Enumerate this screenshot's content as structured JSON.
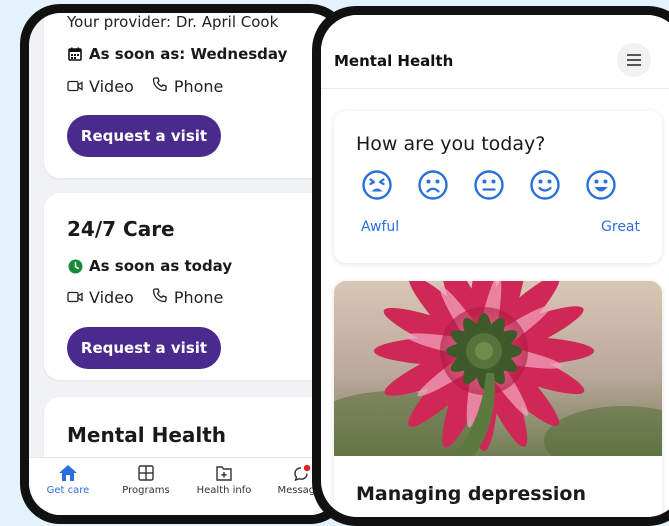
{
  "left": {
    "card1": {
      "provider": "Your provider: Dr. April Cook",
      "availability": "As soon as: Wednesday",
      "video_label": "Video",
      "phone_label": "Phone",
      "button": "Request a visit"
    },
    "card2": {
      "title": "24/7 Care",
      "availability": "As soon as today",
      "video_label": "Video",
      "phone_label": "Phone",
      "button": "Request a visit"
    },
    "card3": {
      "title": "Mental Health"
    },
    "nav": [
      {
        "label": "Get care",
        "icon": "home-icon",
        "active": true
      },
      {
        "label": "Programs",
        "icon": "grid-icon"
      },
      {
        "label": "Health info",
        "icon": "folder-plus-icon"
      },
      {
        "label": "Messages",
        "icon": "chat-icon"
      }
    ]
  },
  "right": {
    "header": {
      "title": "Mental Health"
    },
    "mood": {
      "question": "How are you today?",
      "low_label": "Awful",
      "high_label": "Great",
      "faces": [
        "awful-face-icon",
        "sad-face-icon",
        "neutral-face-icon",
        "smile-face-icon",
        "happy-face-icon"
      ]
    },
    "article": {
      "title": "Managing depression"
    }
  },
  "colors": {
    "accent_purple": "#4b2a8e",
    "link_blue": "#2a6fdb",
    "available_green": "#1a8a3a",
    "notification_red": "#e02424"
  }
}
